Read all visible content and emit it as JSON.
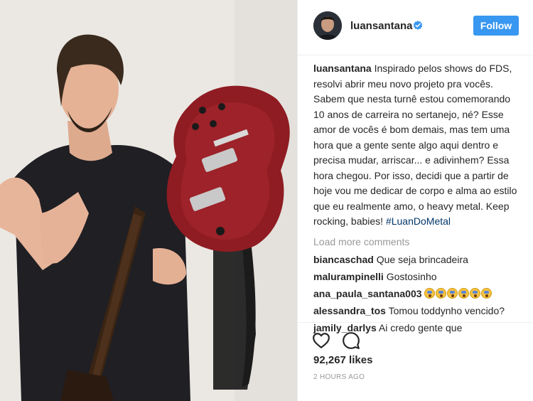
{
  "post": {
    "username": "luansantana",
    "follow_label": "Follow",
    "caption_user": "luansantana",
    "caption_text": " Inspirado pelos shows do FDS, resolvi abrir meu novo projeto pra vocês. Sabem que nesta turnê estou comemorando 10 anos de carreira no sertanejo, né? Esse amor de vocês é bom demais, mas tem uma hora que a gente sente algo aqui dentro e precisa mudar, arriscar... e adivinhem? Essa hora chegou. Por isso, decidi que a partir de hoje vou me dedicar de corpo e alma ao estilo que eu realmente amo, o heavy metal. Keep rocking, babies! ",
    "hashtag": "#LuanDoMetal",
    "load_more": "Load more comments",
    "likes": "92,267 likes",
    "timestamp": "2 HOURS AGO"
  },
  "comments": [
    {
      "user": "biancaschad",
      "text": " Que seja brincadeira"
    },
    {
      "user": "malurampinelli",
      "text": " Gostosinho"
    },
    {
      "user": "ana_paula_santana003",
      "text": " ",
      "emoji_count": 6
    },
    {
      "user": "alessandra_tos",
      "text": " Tomou toddynho vencido?"
    },
    {
      "user": "jamily_darlys",
      "text": " Ai credo gente que"
    }
  ],
  "colors": {
    "follow_button": "#3897f0",
    "verified_badge": "#3897f0",
    "hashtag": "#003569",
    "muted_text": "#999999",
    "guitar_body": "#8f1c22"
  },
  "icons": {
    "verified": "verified-badge-icon",
    "like": "heart-icon",
    "comment": "comment-bubble-icon",
    "emoji": "screaming-face-emoji"
  }
}
